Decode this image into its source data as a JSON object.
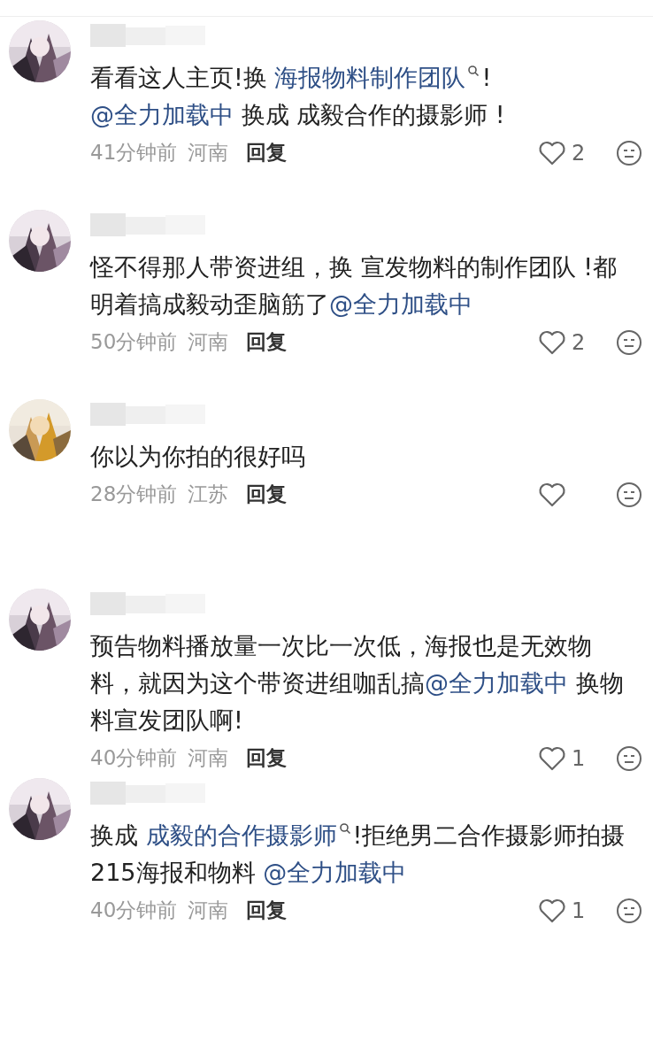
{
  "comments": [
    {
      "segments": [
        {
          "kind": "plain",
          "text": "看看这人主页!换 "
        },
        {
          "kind": "topic",
          "text": "海报物料制作团队"
        },
        {
          "kind": "plain",
          "text": "!"
        },
        {
          "kind": "mention",
          "text": "@全力加载中"
        },
        {
          "kind": "plain",
          "text": "  换成 成毅合作的摄影师 !"
        }
      ],
      "time": "41分钟前",
      "location": "河南",
      "reply": "回复",
      "likes": "2"
    },
    {
      "segments": [
        {
          "kind": "plain",
          "text": "怪不得那人带资进组，换 宣发物料的制作团队 !都明着搞成毅动歪脑筋了"
        },
        {
          "kind": "mention",
          "text": "@全力加载中"
        }
      ],
      "time": "50分钟前",
      "location": "河南",
      "reply": "回复",
      "likes": "2"
    },
    {
      "segments": [
        {
          "kind": "plain",
          "text": "你以为你拍的很好吗"
        }
      ],
      "time": "28分钟前",
      "location": "江苏",
      "reply": "回复"
    },
    {
      "segments": [
        {
          "kind": "plain",
          "text": "预告物料播放量一次比一次低，海报也是无效物料，就因为这个带资进组咖乱搞"
        },
        {
          "kind": "mention",
          "text": "@全力加载中"
        },
        {
          "kind": "plain",
          "text": " 换物料宣发团队啊!"
        }
      ],
      "time": "40分钟前",
      "location": "河南",
      "reply": "回复",
      "likes": "1"
    },
    {
      "segments": [
        {
          "kind": "plain",
          "text": "换成 "
        },
        {
          "kind": "topic",
          "text": "成毅的合作摄影师"
        },
        {
          "kind": "plain",
          "text": "!拒绝男二合作摄影师拍摄 215海报和物料  "
        },
        {
          "kind": "mention",
          "text": "@全力加载中"
        }
      ],
      "time": "40分钟前",
      "location": "河南",
      "reply": "回复",
      "likes": "1"
    }
  ]
}
